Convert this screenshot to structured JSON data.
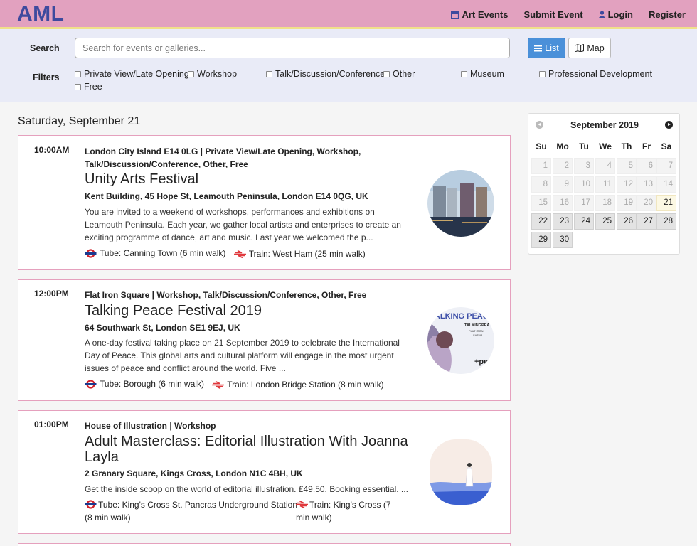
{
  "header": {
    "logo": "AML",
    "nav": {
      "art_events": "Art Events",
      "submit_event": "Submit Event",
      "login": "Login",
      "register": "Register"
    }
  },
  "search": {
    "label": "Search",
    "placeholder": "Search for events or galleries...",
    "value": "",
    "list_button": "List",
    "map_button": "Map"
  },
  "filters": {
    "label": "Filters",
    "options": [
      "Private View/Late Opening",
      "Workshop",
      "Talk/Discussion/Conference",
      "Other",
      "Museum",
      "Professional Development",
      "Free"
    ]
  },
  "date_heading": "Saturday, September 21",
  "events": [
    {
      "time": "10:00AM",
      "meta": "London City Island E14 0LG | Private View/Late Opening, Workshop, Talk/Discussion/Conference, Other, Free",
      "title": "Unity Arts Festival",
      "address": "Kent Building, 45 Hope St, Leamouth Peninsula, London E14 0QG, UK",
      "description": "You are invited to a weekend of workshops, performances and exhibitions on Leamouth Peninsula. Each year, we gather local artists and enterprises to create an exciting programme of dance, art and music. Last year we welcomed the p...",
      "tube": "Tube: Canning Town (6 min walk)",
      "train": "Train: West Ham (25 min walk)"
    },
    {
      "time": "12:00PM",
      "meta": "Flat Iron Square | Workshop, Talk/Discussion/Conference, Other, Free",
      "title": "Talking Peace Festival 2019",
      "address": "64 Southwark St, London SE1 9EJ, UK",
      "description": "A one-day festival taking place on 21 September 2019 to celebrate the International Day of Peace. This global arts and cultural platform will engage in the most urgent issues of peace and conflict around the world.    Five ...",
      "tube": "Tube: Borough (6 min walk)",
      "train": "Train: London Bridge Station (8 min walk)",
      "image_text": "TALKING PEACE",
      "image_subtext": "TALKINGPEA",
      "image_subtext2": "FLAT IRON",
      "image_subtext3": "SATUR",
      "image_brand": "+pe"
    },
    {
      "time": "01:00PM",
      "meta": "House of Illustration | Workshop",
      "title": "Adult Masterclass: Editorial Illustration With Joanna Layla",
      "address": "2 Granary Square, Kings Cross, London N1C 4BH, UK",
      "description": "Get the inside scoop on the world of editorial illustration. £49.50. Booking essential. ...",
      "tube": "Tube: King's Cross St. Pancras Underground Station (8 min walk)",
      "train": "Train: King's Cross (7 min walk)"
    }
  ],
  "calendar": {
    "title": "September 2019",
    "dow": [
      "Su",
      "Mo",
      "Tu",
      "We",
      "Th",
      "Fr",
      "Sa"
    ],
    "days": [
      "1",
      "2",
      "3",
      "4",
      "5",
      "6",
      "7",
      "8",
      "9",
      "10",
      "11",
      "12",
      "13",
      "14",
      "15",
      "16",
      "17",
      "18",
      "19",
      "20",
      "21",
      "22",
      "23",
      "24",
      "25",
      "26",
      "27",
      "28",
      "29",
      "30"
    ],
    "today": "21"
  },
  "colors": {
    "header_bg": "#e2a1bf",
    "logo": "#3d4a9e",
    "accent_border": "#e5a0bd",
    "list_button": "#4a90d9",
    "search_panel_bg": "#e9ebf7"
  }
}
